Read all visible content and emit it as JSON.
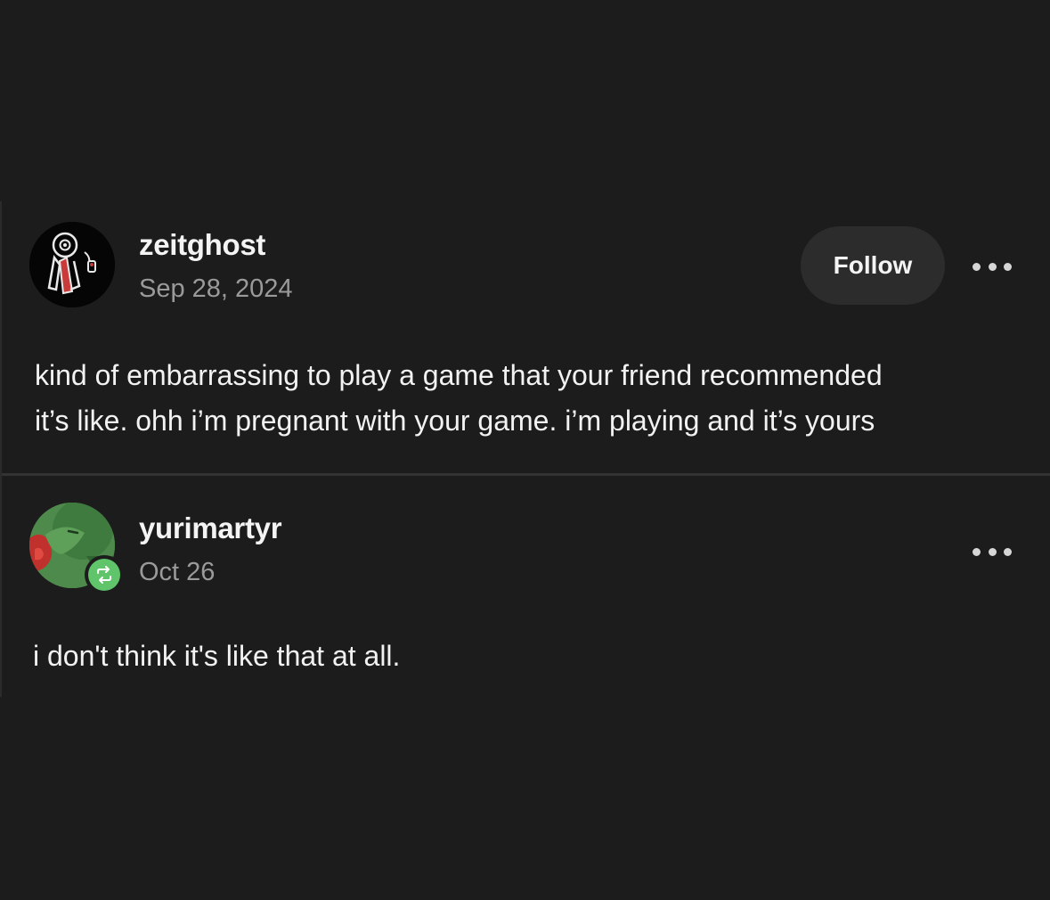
{
  "posts": [
    {
      "username": "zeitghost",
      "date": "Sep 28, 2024",
      "follow_label": "Follow",
      "more_icon": "more-horizontal-icon",
      "avatar": "ornate-eye-avatar",
      "body_lines": [
        "kind of embarrassing to play a game that your friend recommended",
        "it’s like. ohh i’m pregnant with your game. i’m playing and it’s yours"
      ]
    },
    {
      "username": "yurimartyr",
      "date": "Oct 26",
      "more_icon": "more-horizontal-icon",
      "avatar": "green-creature-avatar",
      "badge_icon": "reblog-icon",
      "badge_color": "#5fc46a",
      "body_lines": [
        "i don't think it's like that at all."
      ]
    }
  ],
  "colors": {
    "background": "#1c1c1c",
    "text": "#f2f2f2",
    "muted_text": "#9a9a9a",
    "button_bg": "#2c2c2c",
    "divider": "#333333"
  }
}
